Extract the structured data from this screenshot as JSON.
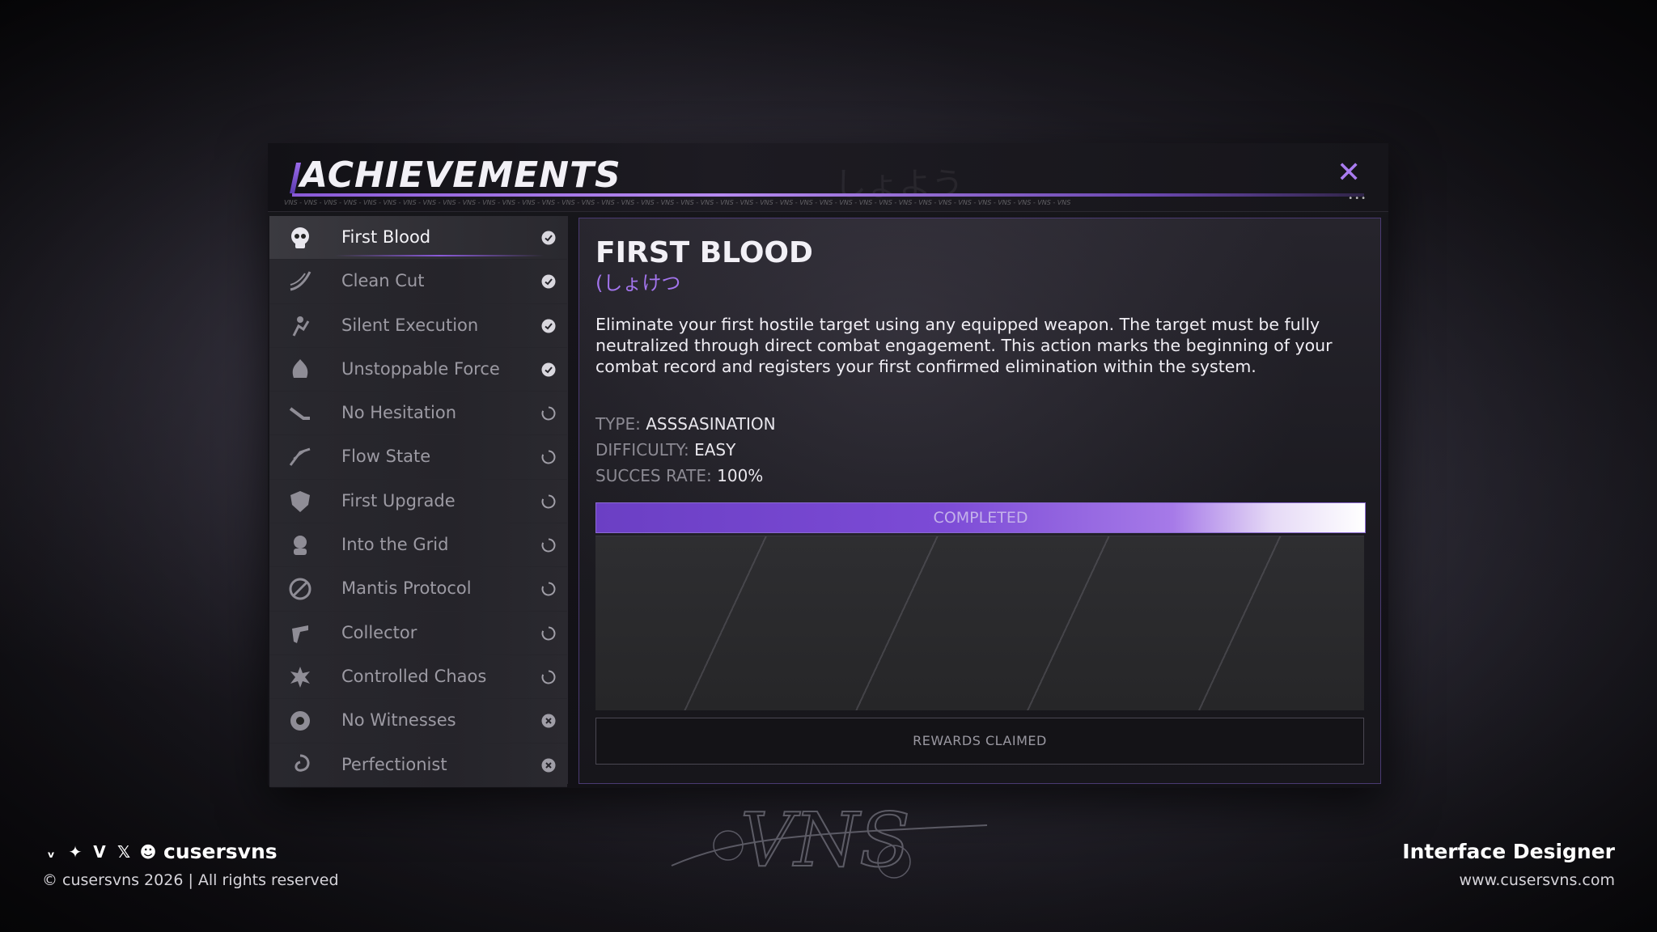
{
  "window": {
    "title": "ACHIEVEMENTS",
    "title_ghost": "しょよう",
    "close_icon": "close-icon",
    "tagline": "VNS - VNS - VNS - VNS - VNS - VNS - VNS - VNS - VNS - VNS - VNS - VNS - VNS - VNS - VNS - VNS - VNS - VNS - VNS - VNS - VNS - VNS - VNS - VNS - VNS - VNS - VNS - VNS - VNS - VNS - VNS - VNS - VNS - VNS - VNS - VNS - VNS - VNS - VNS - VNS",
    "accent_color": "#8a5ad8"
  },
  "achievements": [
    {
      "label": "First Blood",
      "icon": "skull-icon",
      "status": "completed",
      "active": true
    },
    {
      "label": "Clean Cut",
      "icon": "slash-icon",
      "status": "completed"
    },
    {
      "label": "Silent Execution",
      "icon": "ninja-icon",
      "status": "completed"
    },
    {
      "label": "Unstoppable Force",
      "icon": "flame-icon",
      "status": "completed"
    },
    {
      "label": "No Hesitation",
      "icon": "dash-icon",
      "status": "in-progress"
    },
    {
      "label": "Flow State",
      "icon": "speed-icon",
      "status": "in-progress"
    },
    {
      "label": "First Upgrade",
      "icon": "shield-icon",
      "status": "in-progress"
    },
    {
      "label": "Into the Grid",
      "icon": "hacker-icon",
      "status": "in-progress"
    },
    {
      "label": "Mantis Protocol",
      "icon": "blade-icon",
      "status": "in-progress"
    },
    {
      "label": "Collector",
      "icon": "gun-icon",
      "status": "in-progress"
    },
    {
      "label": "Controlled Chaos",
      "icon": "explosion-icon",
      "status": "in-progress"
    },
    {
      "label": "No Witnesses",
      "icon": "eye-icon",
      "status": "locked"
    },
    {
      "label": "Perfectionist",
      "icon": "swirl-icon",
      "status": "locked"
    }
  ],
  "detail": {
    "title": "FIRST BLOOD",
    "subtitle": "(しょけつ",
    "description": "Eliminate your first hostile target using any equipped weapon. The target must be fully neutralized through direct combat engagement. This action marks the beginning of your combat record and registers your first confirmed elimination within the system.",
    "type_label": "TYPE:",
    "type_value": "ASSSASINATION",
    "difficulty_label": "DIFFICULTY:",
    "difficulty_value": "EASY",
    "rate_label": "SUCCES RATE:",
    "rate_value": "100%",
    "progress_label": "COMPLETED",
    "progress": 1.0,
    "reward_label": "REWARDS CLAIMED"
  },
  "footer": {
    "handle": "cusersvns",
    "copyright": "© cusersvns 2026 | All rights reserved",
    "role": "Interface Designer",
    "url": "www.cusersvns.com",
    "social_icons": [
      "vk-icon",
      "star-icon",
      "v-icon",
      "x-icon",
      "discord-icon"
    ]
  },
  "watermark_text": "VNS"
}
